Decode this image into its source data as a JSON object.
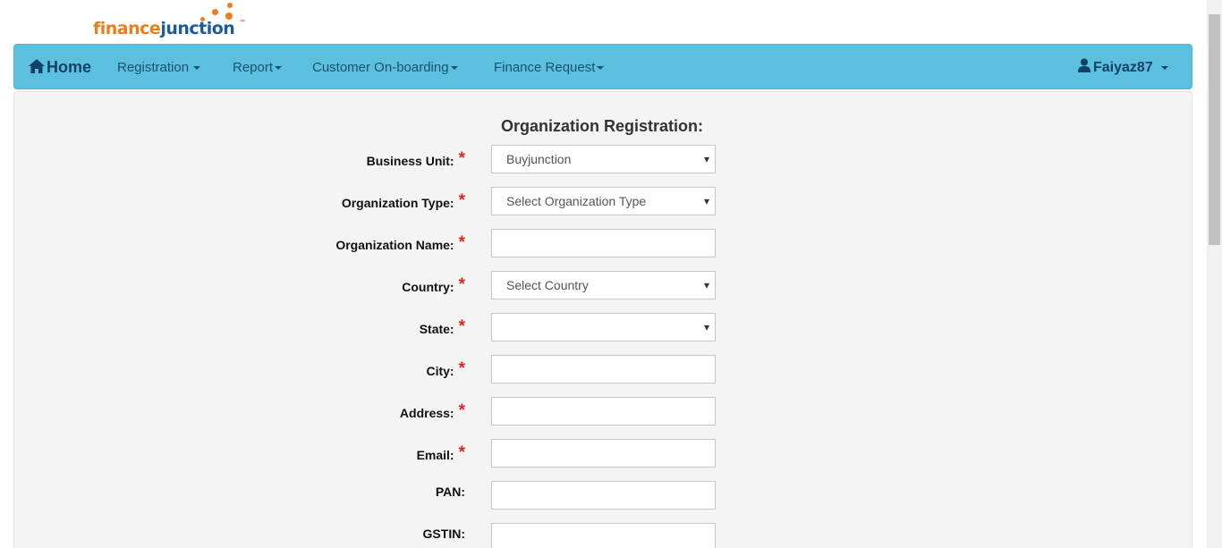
{
  "brand": {
    "part1": "finance",
    "part2": "junction",
    "tm": "™"
  },
  "nav": {
    "home": "Home",
    "registration": "Registration",
    "report": "Report",
    "onboarding": "Customer On-boarding",
    "finance_request": "Finance Request",
    "user": "Faiyaz87"
  },
  "form": {
    "title": "Organization Registration:",
    "business_unit": {
      "label": "Business Unit:",
      "value": "Buyjunction"
    },
    "org_type": {
      "label": "Organization Type:",
      "value": "Select Organization Type"
    },
    "org_name": {
      "label": "Organization Name:",
      "value": ""
    },
    "country": {
      "label": "Country:",
      "value": "Select Country"
    },
    "state": {
      "label": "State:",
      "value": ""
    },
    "city": {
      "label": "City:",
      "value": ""
    },
    "address": {
      "label": "Address:",
      "value": ""
    },
    "email": {
      "label": "Email:",
      "value": ""
    },
    "pan": {
      "label": "PAN:",
      "value": ""
    },
    "gstin": {
      "label": "GSTIN:",
      "value": ""
    },
    "required_mark": "*"
  },
  "colors": {
    "navbar": "#5bc0de",
    "required": "#e0261b",
    "brand_orange": "#ee7d1b",
    "brand_blue": "#1e5a9f"
  }
}
